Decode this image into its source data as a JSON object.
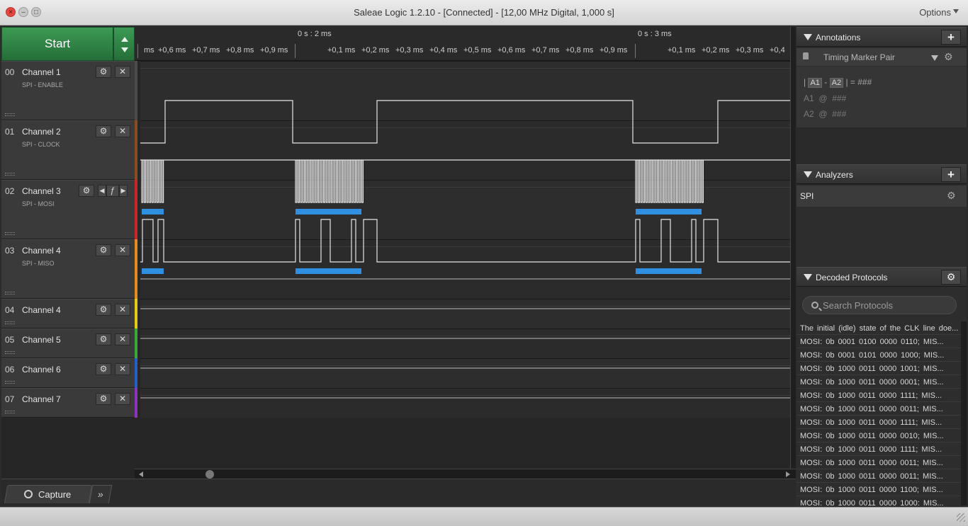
{
  "window": {
    "title": "Saleae Logic 1.2.10 - [Connected] - [12,00 MHz Digital, 1,000 s]",
    "options_label": "Options"
  },
  "toolbar": {
    "start_label": "Start"
  },
  "ruler": {
    "major": [
      "0 s : 2 ms",
      "0 s : 3 ms"
    ],
    "minor": [
      "ms",
      "+0,6 ms",
      "+0,7 ms",
      "+0,8 ms",
      "+0,9 ms",
      "+0,1 ms",
      "+0,2 ms",
      "+0,3 ms",
      "+0,4 ms",
      "+0,5 ms",
      "+0,6 ms",
      "+0,7 ms",
      "+0,8 ms",
      "+0,9 ms",
      "+0,1 ms",
      "+0,2 ms",
      "+0,3 ms",
      "+0,4"
    ]
  },
  "channels": [
    {
      "num": "00",
      "name": "Channel 1",
      "sub": "SPI - ENABLE",
      "color": "#4a4a4a"
    },
    {
      "num": "01",
      "name": "Channel 2",
      "sub": "SPI - CLOCK",
      "color": "#8a4a22"
    },
    {
      "num": "02",
      "name": "Channel 3",
      "sub": "SPI - MOSI",
      "color": "#c4262a"
    },
    {
      "num": "03",
      "name": "Channel 4",
      "sub": "SPI - MISO",
      "color": "#e58a1e"
    },
    {
      "num": "04",
      "name": "Channel 4",
      "sub": "",
      "color": "#e4c91a"
    },
    {
      "num": "05",
      "name": "Channel 5",
      "sub": "",
      "color": "#3ea43c"
    },
    {
      "num": "06",
      "name": "Channel 6",
      "sub": "",
      "color": "#2a5cc4"
    },
    {
      "num": "07",
      "name": "Channel 7",
      "sub": "",
      "color": "#8a34b8"
    }
  ],
  "icons": {
    "settings": "gear-icon",
    "remove": "close-icon",
    "trigger": "trigger-edge-icon"
  },
  "colors": {
    "decode_bar": "#2f8fe0",
    "start_green": "#2f8a48"
  },
  "annotations": {
    "title": "Annotations",
    "marker_type": "Timing Marker Pair",
    "marker_a": "A1",
    "marker_b": "A2",
    "pair_sep": "-",
    "pair_value": "= ###",
    "at": "@",
    "value": "###"
  },
  "analyzers": {
    "title": "Analyzers",
    "items": [
      {
        "label": "SPI"
      }
    ]
  },
  "decoded": {
    "title": "Decoded Protocols",
    "search_placeholder": "Search Protocols",
    "rows": [
      "The initial (idle) state of the CLK line doe...",
      "MOSI: 0b  0001  0100  0000  0110;  MIS...",
      "MOSI: 0b  0001  0101  0000  1000;  MIS...",
      "MOSI: 0b  1000  0011  0000  1001;  MIS...",
      "MOSI: 0b  1000  0011  0000  0001;  MIS...",
      "MOSI: 0b  1000  0011  0000  1111;  MIS...",
      "MOSI: 0b  1000  0011  0000  0011;  MIS...",
      "MOSI: 0b  1000  0011  0000  1111;  MIS...",
      "MOSI: 0b  1000  0011  0000  0010;  MIS...",
      "MOSI: 0b  1000  0011  0000  1111;  MIS...",
      "MOSI: 0b  1000  0011  0000  0011;  MIS...",
      "MOSI: 0b  1000  0011  0000  0011;  MIS...",
      "MOSI: 0b  1000  0011  0000  1100;  MIS...",
      "MOSI: 0b  1000  0011  0000  1000;  MIS..."
    ]
  },
  "tabs": {
    "capture_label": "Capture",
    "more_label": "»"
  }
}
